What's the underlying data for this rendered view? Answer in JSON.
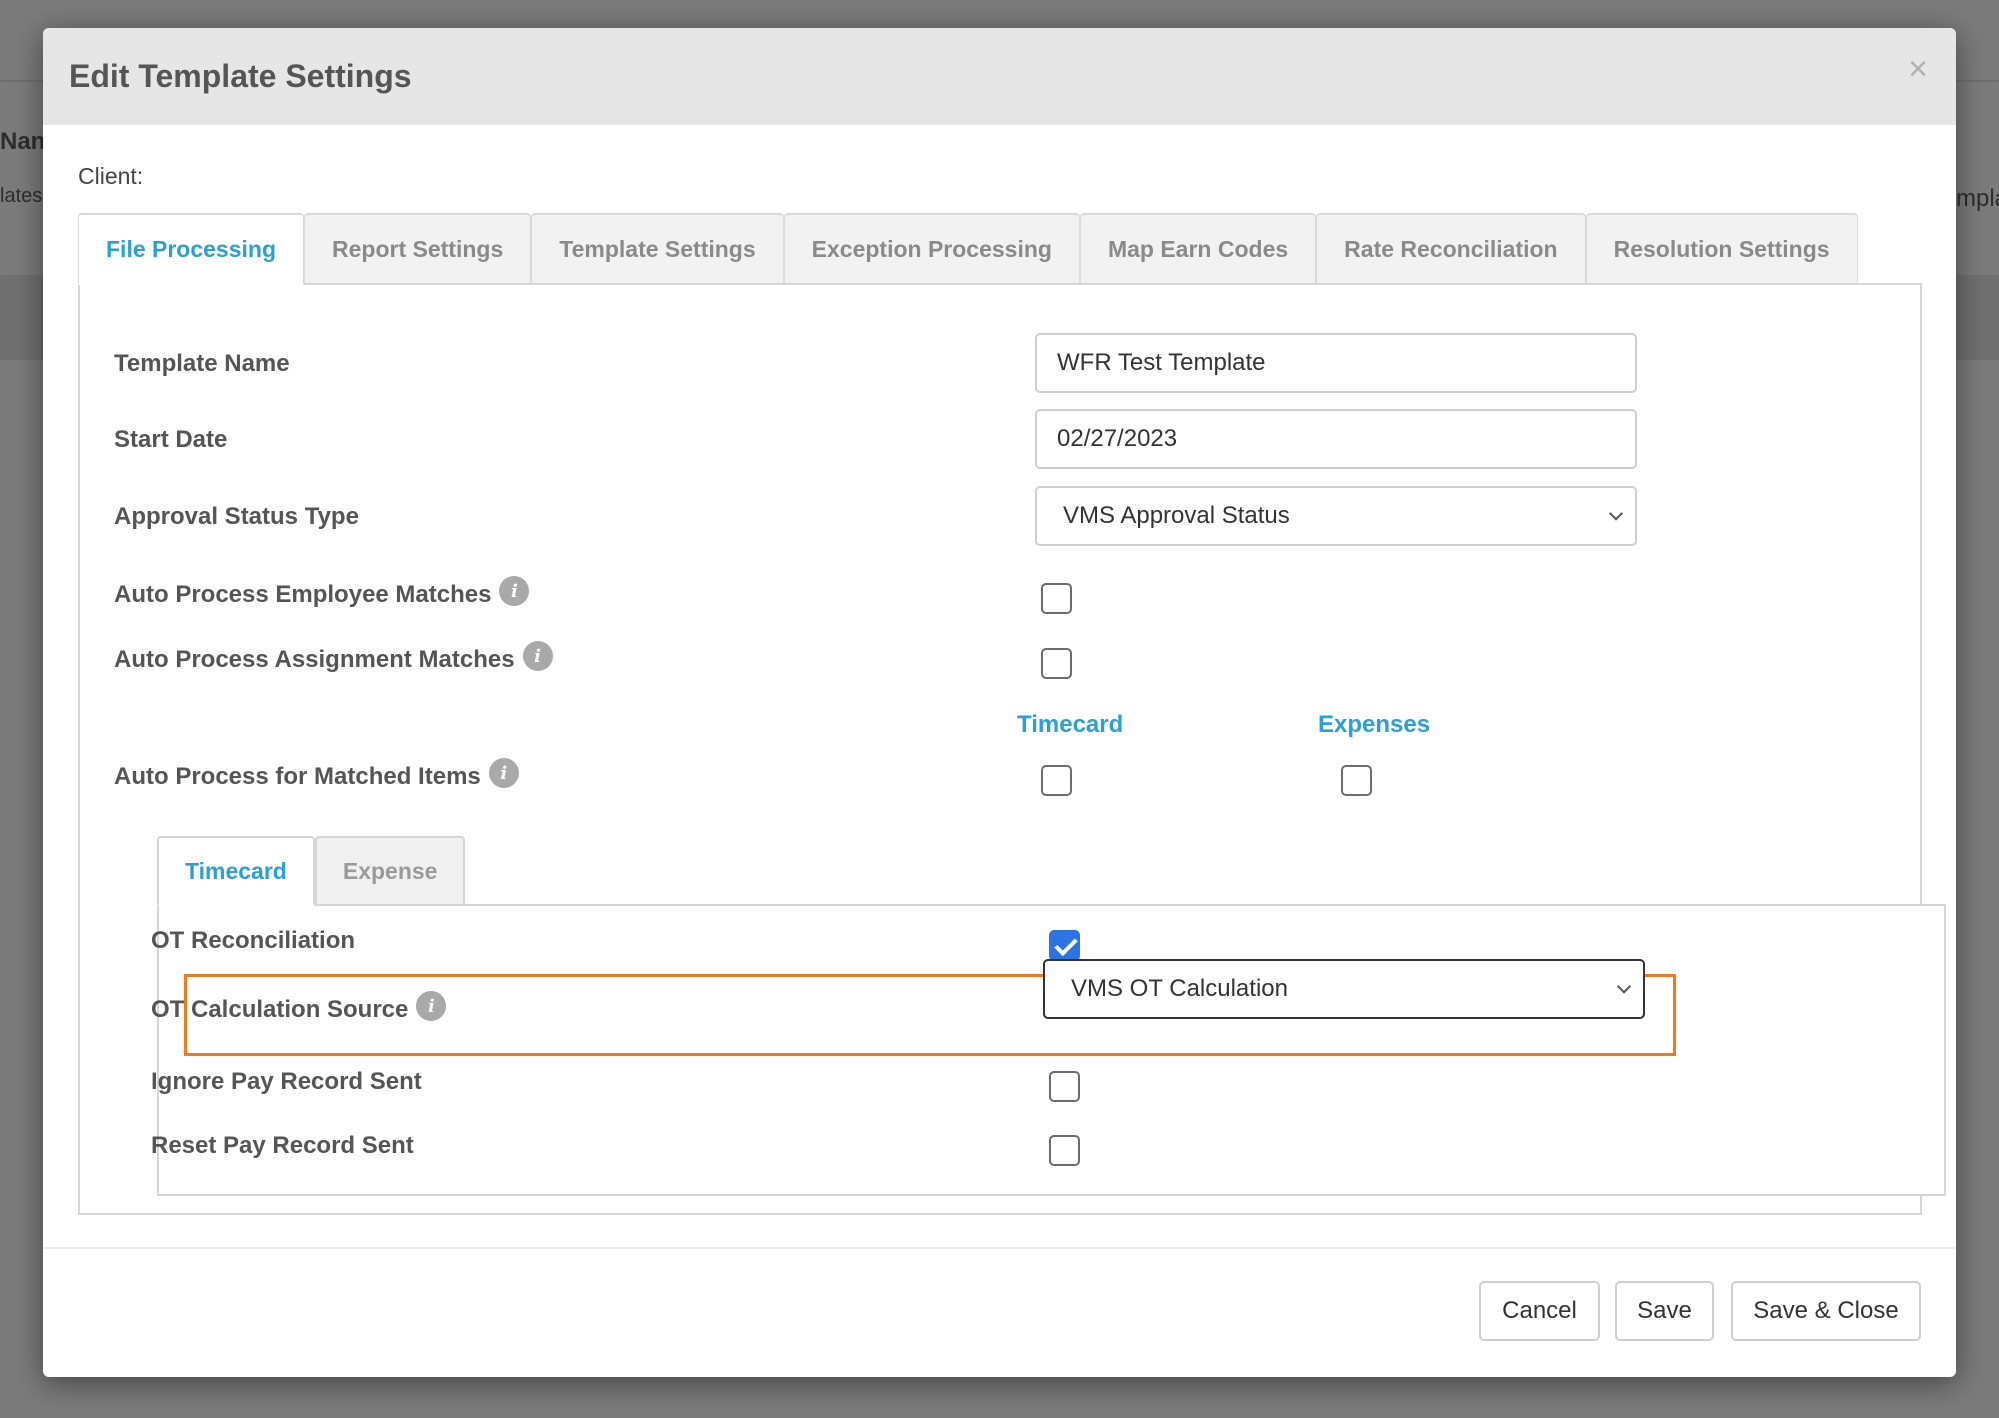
{
  "background": {
    "left_top_fragment": "Nan",
    "left_bottom_fragment": "lates",
    "right_fragment": "mpla"
  },
  "modal": {
    "title": "Edit Template Settings",
    "close_glyph": "×",
    "client_label": "Client:"
  },
  "tabs": [
    {
      "label": "File Processing",
      "active": true
    },
    {
      "label": "Report Settings",
      "active": false
    },
    {
      "label": "Template Settings",
      "active": false
    },
    {
      "label": "Exception Processing",
      "active": false
    },
    {
      "label": "Map Earn Codes",
      "active": false
    },
    {
      "label": "Rate Reconciliation",
      "active": false
    },
    {
      "label": "Resolution Settings",
      "active": false
    }
  ],
  "form": {
    "template_name": {
      "label": "Template Name",
      "value": "WFR Test Template"
    },
    "start_date": {
      "label": "Start Date",
      "value": "02/27/2023"
    },
    "approval_status_type": {
      "label": "Approval Status Type",
      "value": "VMS Approval Status"
    },
    "auto_process_employee": {
      "label": "Auto Process Employee Matches",
      "checked": false
    },
    "auto_process_assignment": {
      "label": "Auto Process Assignment Matches",
      "checked": false
    },
    "matched_items": {
      "label": "Auto Process for Matched Items",
      "col_timecard": "Timecard",
      "col_expenses": "Expenses",
      "timecard_checked": false,
      "expenses_checked": false
    }
  },
  "inner_tabs": [
    {
      "label": "Timecard",
      "active": true
    },
    {
      "label": "Expense",
      "active": false
    }
  ],
  "timecard": {
    "ot_reconciliation": {
      "label": "OT Reconciliation",
      "checked": true
    },
    "ot_calculation_source": {
      "label": "OT Calculation Source",
      "value": "VMS OT Calculation"
    },
    "ignore_pay_record_sent": {
      "label": "Ignore Pay Record Sent",
      "checked": false
    },
    "reset_pay_record_sent": {
      "label": "Reset Pay Record Sent",
      "checked": false
    }
  },
  "info_glyph": "i",
  "footer": {
    "cancel": "Cancel",
    "save": "Save",
    "save_close": "Save & Close"
  },
  "colors": {
    "accent": "#2a9fd8",
    "highlight": "#ef7a22",
    "checkbox_checked": "#2c73e4"
  }
}
